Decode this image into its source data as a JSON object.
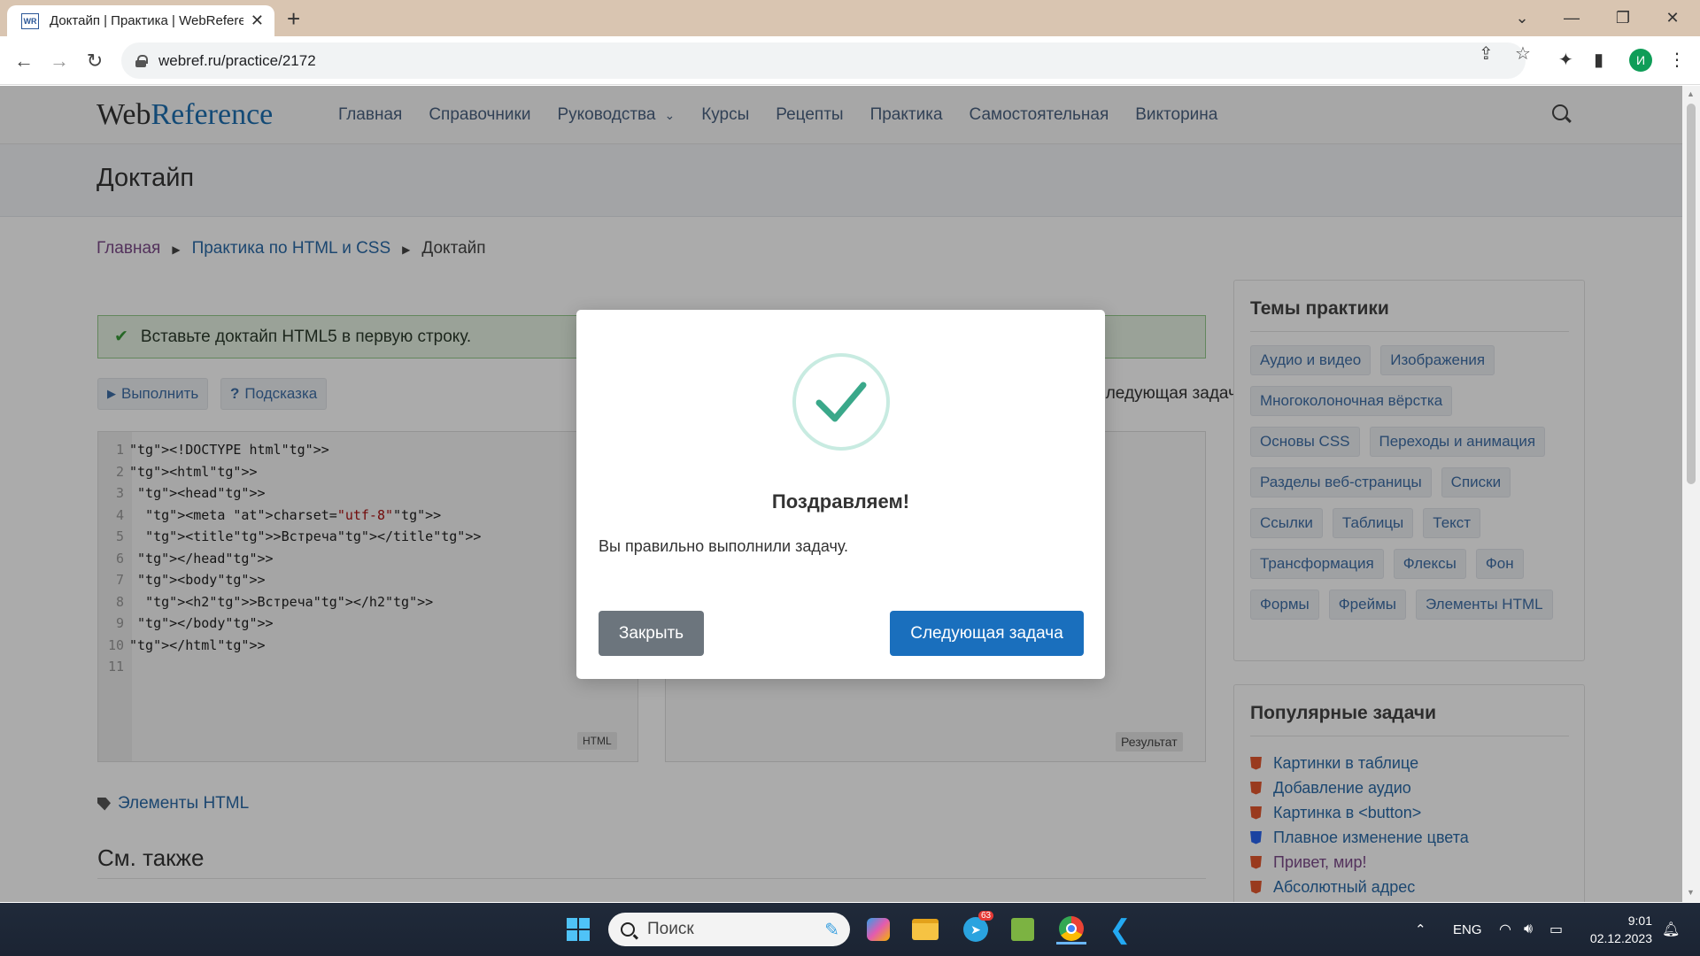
{
  "browser": {
    "tab_title": "Доктайп | Практика | WebReference",
    "favicon_text": "WR",
    "url": "webref.ru/practice/2172",
    "profile_initial": "И"
  },
  "site": {
    "logo_part1": "Web",
    "logo_part2": "Reference",
    "nav": [
      "Главная",
      "Справочники",
      "Руководства",
      "Курсы",
      "Рецепты",
      "Практика",
      "Самостоятельная",
      "Викторина"
    ],
    "page_title": "Доктайп",
    "breadcrumbs": [
      "Главная",
      "Практика по HTML и CSS",
      "Доктайп"
    ],
    "task_text": "Вставьте доктайп HTML5 в первую строку.",
    "run_button": "Выполнить",
    "hint_button": "Подсказка",
    "next_task_link": "Следующая задача",
    "editor_label": "HTML",
    "result_label": "Результат",
    "code_lines": [
      "<!DOCTYPE html>",
      "<html>",
      " <head>",
      "  <meta charset=\"utf-8\">",
      "  <title>Встреча</title>",
      " </head>",
      " <body>",
      "  <h2>Встреча</h2>",
      " </body>",
      "</html>",
      ""
    ],
    "tag_link": "Элементы HTML",
    "see_also": "См. также"
  },
  "sidebar": {
    "topics_title": "Темы практики",
    "topics": [
      "Аудио и видео",
      "Изображения",
      "Многоколоночная вёрстка",
      "Основы CSS",
      "Переходы и анимация",
      "Разделы веб-страницы",
      "Списки",
      "Ссылки",
      "Таблицы",
      "Текст",
      "Трансформация",
      "Флексы",
      "Фон",
      "Формы",
      "Фреймы",
      "Элементы HTML"
    ],
    "popular_title": "Популярные задачи",
    "popular": [
      {
        "label": "Картинки в таблице",
        "icon": "html5-icon",
        "visited": false
      },
      {
        "label": "Добавление аудио",
        "icon": "html5-icon",
        "visited": false
      },
      {
        "label": "Картинка в <button>",
        "icon": "html5-icon",
        "visited": false
      },
      {
        "label": "Плавное изменение цвета",
        "icon": "css3-icon",
        "visited": false
      },
      {
        "label": "Привет, мир!",
        "icon": "html5-icon",
        "visited": true
      },
      {
        "label": "Абсолютный адрес",
        "icon": "html5-icon",
        "visited": false
      }
    ]
  },
  "modal": {
    "title": "Поздравляем!",
    "message": "Вы правильно выполнили задачу.",
    "close_button": "Закрыть",
    "next_button": "Следующая задача"
  },
  "taskbar": {
    "search_placeholder": "Поиск",
    "language": "ENG",
    "time": "9:01",
    "date": "02.12.2023",
    "telegram_badge": "63"
  },
  "colors": {
    "accent": "#1a6fbd",
    "success": "#3aa88a",
    "secondary": "#6c757d"
  }
}
